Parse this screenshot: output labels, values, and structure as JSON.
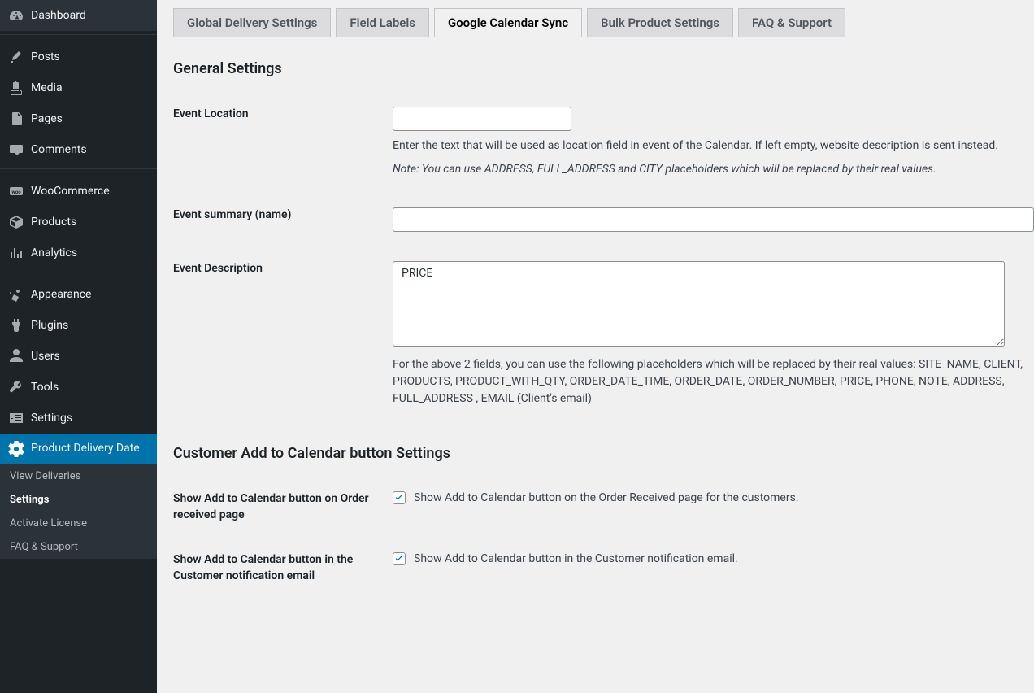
{
  "sidebar": {
    "items": [
      {
        "label": "Dashboard",
        "icon": "dashboard"
      },
      {
        "label": "Posts",
        "icon": "posts"
      },
      {
        "label": "Media",
        "icon": "media"
      },
      {
        "label": "Pages",
        "icon": "pages"
      },
      {
        "label": "Comments",
        "icon": "comments"
      },
      {
        "label": "WooCommerce",
        "icon": "woocommerce"
      },
      {
        "label": "Products",
        "icon": "products"
      },
      {
        "label": "Analytics",
        "icon": "analytics"
      },
      {
        "label": "Appearance",
        "icon": "appearance"
      },
      {
        "label": "Plugins",
        "icon": "plugins"
      },
      {
        "label": "Users",
        "icon": "users"
      },
      {
        "label": "Tools",
        "icon": "tools"
      },
      {
        "label": "Settings",
        "icon": "settings"
      },
      {
        "label": "Product Delivery Date",
        "icon": "gear"
      }
    ],
    "submenu": [
      {
        "label": "View Deliveries"
      },
      {
        "label": "Settings"
      },
      {
        "label": "Activate License"
      },
      {
        "label": "FAQ & Support"
      }
    ]
  },
  "tabs": [
    {
      "label": "Global Delivery Settings"
    },
    {
      "label": "Field Labels"
    },
    {
      "label": "Google Calendar Sync"
    },
    {
      "label": "Bulk Product Settings"
    },
    {
      "label": "FAQ & Support"
    }
  ],
  "sections": {
    "general": {
      "title": "General Settings",
      "event_location": {
        "label": "Event Location",
        "value": "",
        "help": "Enter the text that will be used as location field in event of the Calendar. If left empty, website description is sent instead.",
        "note": "Note: You can use ADDRESS, FULL_ADDRESS and CITY placeholders which will be replaced by their real values."
      },
      "event_summary": {
        "label": "Event summary (name)",
        "value": ""
      },
      "event_description": {
        "label": "Event Description",
        "value": "PRICE",
        "help": "For the above 2 fields, you can use the following placeholders which will be replaced by their real values: SITE_NAME, CLIENT, PRODUCTS, PRODUCT_WITH_QTY, ORDER_DATE_TIME, ORDER_DATE, ORDER_NUMBER, PRICE, PHONE, NOTE, ADDRESS, FULL_ADDRESS , EMAIL (Client's email)"
      }
    },
    "customer": {
      "title": "Customer Add to Calendar button Settings",
      "show_order_received": {
        "label": "Show Add to Calendar button on Order received page",
        "checked": true,
        "checkbox_label": "Show Add to Calendar button on the Order Received page for the customers."
      },
      "show_notification_email": {
        "label": "Show Add to Calendar button in the Customer notification email",
        "checked": true,
        "checkbox_label": "Show Add to Calendar button in the Customer notification email."
      }
    }
  }
}
